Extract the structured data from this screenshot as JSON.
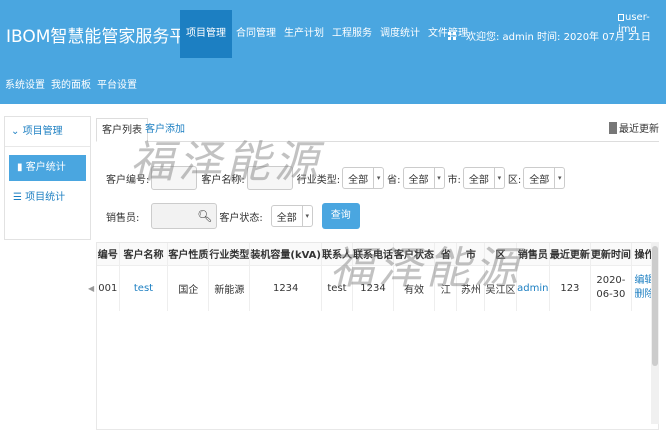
{
  "header": {
    "brand": "IBOM智慧能管家服务平台",
    "nav": [
      "项目管理",
      "合同管理",
      "生产计划",
      "工程服务",
      "调度统计",
      "文件管理"
    ],
    "active_nav": "项目管理",
    "welcome": "欢迎您: admin 时间: 2020年 07月 21日",
    "user_img_alt": "user-img",
    "subnav": [
      "系统设置",
      "我的面板",
      "平台设置"
    ]
  },
  "sidebar": {
    "title": "项目管理",
    "items": [
      "客户统计",
      "项目统计"
    ],
    "active_item": "客户统计"
  },
  "tabs": {
    "list": "客户列表",
    "add": "客户添加",
    "refresh": "最近更新"
  },
  "filters": {
    "customer_code_label": "客户编号:",
    "customer_name_label": "客户名称:",
    "industry_label": "行业类型:",
    "industry_value": "全部",
    "province_label": "省:",
    "province_value": "全部",
    "city_label": "市:",
    "city_value": "全部",
    "district_label": "区:",
    "district_value": "全部",
    "sales_label": "销售员:",
    "status_label": "客户状态:",
    "status_value": "全部",
    "query_button": "查询"
  },
  "table": {
    "columns": [
      "编号",
      "客户名称",
      "客户性质",
      "行业类型",
      "装机容量(kVA)",
      "联系人",
      "联系电话",
      "客户状态",
      "省",
      "市",
      "区",
      "销售员",
      "最近更新",
      "更新时间",
      "操作"
    ],
    "rows": [
      {
        "id": "001",
        "name": "test",
        "nature": "国企",
        "industry": "新能源",
        "capacity": "1234",
        "contact": "test",
        "phone": "1234",
        "status": "有效",
        "province": "江",
        "city": "苏州",
        "district": "吴江区",
        "sales": "admin",
        "recent": "123",
        "updated": "2020-06-30",
        "op_edit": "编辑",
        "op_delete": "删除"
      }
    ]
  },
  "watermark": "福泽能源",
  "colors": {
    "header_bg": "#4aa6e0",
    "active_nav_bg": "#1c7fc2",
    "link": "#1c7fc2"
  }
}
